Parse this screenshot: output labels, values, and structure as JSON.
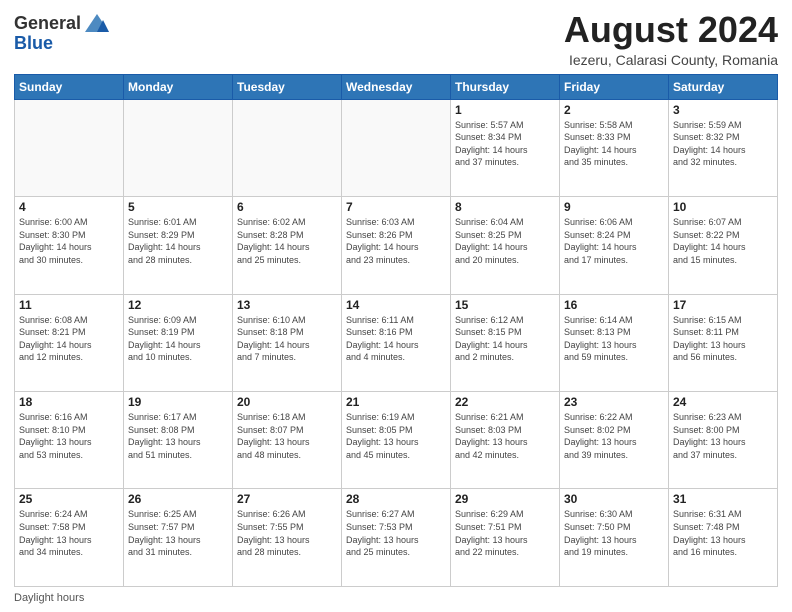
{
  "header": {
    "logo_general": "General",
    "logo_blue": "Blue",
    "main_title": "August 2024",
    "subtitle": "Iezeru, Calarasi County, Romania"
  },
  "days_of_week": [
    "Sunday",
    "Monday",
    "Tuesday",
    "Wednesday",
    "Thursday",
    "Friday",
    "Saturday"
  ],
  "footer": {
    "daylight_label": "Daylight hours"
  },
  "weeks": [
    {
      "days": [
        {
          "num": "",
          "info": ""
        },
        {
          "num": "",
          "info": ""
        },
        {
          "num": "",
          "info": ""
        },
        {
          "num": "",
          "info": ""
        },
        {
          "num": "1",
          "info": "Sunrise: 5:57 AM\nSunset: 8:34 PM\nDaylight: 14 hours\nand 37 minutes."
        },
        {
          "num": "2",
          "info": "Sunrise: 5:58 AM\nSunset: 8:33 PM\nDaylight: 14 hours\nand 35 minutes."
        },
        {
          "num": "3",
          "info": "Sunrise: 5:59 AM\nSunset: 8:32 PM\nDaylight: 14 hours\nand 32 minutes."
        }
      ]
    },
    {
      "days": [
        {
          "num": "4",
          "info": "Sunrise: 6:00 AM\nSunset: 8:30 PM\nDaylight: 14 hours\nand 30 minutes."
        },
        {
          "num": "5",
          "info": "Sunrise: 6:01 AM\nSunset: 8:29 PM\nDaylight: 14 hours\nand 28 minutes."
        },
        {
          "num": "6",
          "info": "Sunrise: 6:02 AM\nSunset: 8:28 PM\nDaylight: 14 hours\nand 25 minutes."
        },
        {
          "num": "7",
          "info": "Sunrise: 6:03 AM\nSunset: 8:26 PM\nDaylight: 14 hours\nand 23 minutes."
        },
        {
          "num": "8",
          "info": "Sunrise: 6:04 AM\nSunset: 8:25 PM\nDaylight: 14 hours\nand 20 minutes."
        },
        {
          "num": "9",
          "info": "Sunrise: 6:06 AM\nSunset: 8:24 PM\nDaylight: 14 hours\nand 17 minutes."
        },
        {
          "num": "10",
          "info": "Sunrise: 6:07 AM\nSunset: 8:22 PM\nDaylight: 14 hours\nand 15 minutes."
        }
      ]
    },
    {
      "days": [
        {
          "num": "11",
          "info": "Sunrise: 6:08 AM\nSunset: 8:21 PM\nDaylight: 14 hours\nand 12 minutes."
        },
        {
          "num": "12",
          "info": "Sunrise: 6:09 AM\nSunset: 8:19 PM\nDaylight: 14 hours\nand 10 minutes."
        },
        {
          "num": "13",
          "info": "Sunrise: 6:10 AM\nSunset: 8:18 PM\nDaylight: 14 hours\nand 7 minutes."
        },
        {
          "num": "14",
          "info": "Sunrise: 6:11 AM\nSunset: 8:16 PM\nDaylight: 14 hours\nand 4 minutes."
        },
        {
          "num": "15",
          "info": "Sunrise: 6:12 AM\nSunset: 8:15 PM\nDaylight: 14 hours\nand 2 minutes."
        },
        {
          "num": "16",
          "info": "Sunrise: 6:14 AM\nSunset: 8:13 PM\nDaylight: 13 hours\nand 59 minutes."
        },
        {
          "num": "17",
          "info": "Sunrise: 6:15 AM\nSunset: 8:11 PM\nDaylight: 13 hours\nand 56 minutes."
        }
      ]
    },
    {
      "days": [
        {
          "num": "18",
          "info": "Sunrise: 6:16 AM\nSunset: 8:10 PM\nDaylight: 13 hours\nand 53 minutes."
        },
        {
          "num": "19",
          "info": "Sunrise: 6:17 AM\nSunset: 8:08 PM\nDaylight: 13 hours\nand 51 minutes."
        },
        {
          "num": "20",
          "info": "Sunrise: 6:18 AM\nSunset: 8:07 PM\nDaylight: 13 hours\nand 48 minutes."
        },
        {
          "num": "21",
          "info": "Sunrise: 6:19 AM\nSunset: 8:05 PM\nDaylight: 13 hours\nand 45 minutes."
        },
        {
          "num": "22",
          "info": "Sunrise: 6:21 AM\nSunset: 8:03 PM\nDaylight: 13 hours\nand 42 minutes."
        },
        {
          "num": "23",
          "info": "Sunrise: 6:22 AM\nSunset: 8:02 PM\nDaylight: 13 hours\nand 39 minutes."
        },
        {
          "num": "24",
          "info": "Sunrise: 6:23 AM\nSunset: 8:00 PM\nDaylight: 13 hours\nand 37 minutes."
        }
      ]
    },
    {
      "days": [
        {
          "num": "25",
          "info": "Sunrise: 6:24 AM\nSunset: 7:58 PM\nDaylight: 13 hours\nand 34 minutes."
        },
        {
          "num": "26",
          "info": "Sunrise: 6:25 AM\nSunset: 7:57 PM\nDaylight: 13 hours\nand 31 minutes."
        },
        {
          "num": "27",
          "info": "Sunrise: 6:26 AM\nSunset: 7:55 PM\nDaylight: 13 hours\nand 28 minutes."
        },
        {
          "num": "28",
          "info": "Sunrise: 6:27 AM\nSunset: 7:53 PM\nDaylight: 13 hours\nand 25 minutes."
        },
        {
          "num": "29",
          "info": "Sunrise: 6:29 AM\nSunset: 7:51 PM\nDaylight: 13 hours\nand 22 minutes."
        },
        {
          "num": "30",
          "info": "Sunrise: 6:30 AM\nSunset: 7:50 PM\nDaylight: 13 hours\nand 19 minutes."
        },
        {
          "num": "31",
          "info": "Sunrise: 6:31 AM\nSunset: 7:48 PM\nDaylight: 13 hours\nand 16 minutes."
        }
      ]
    }
  ]
}
